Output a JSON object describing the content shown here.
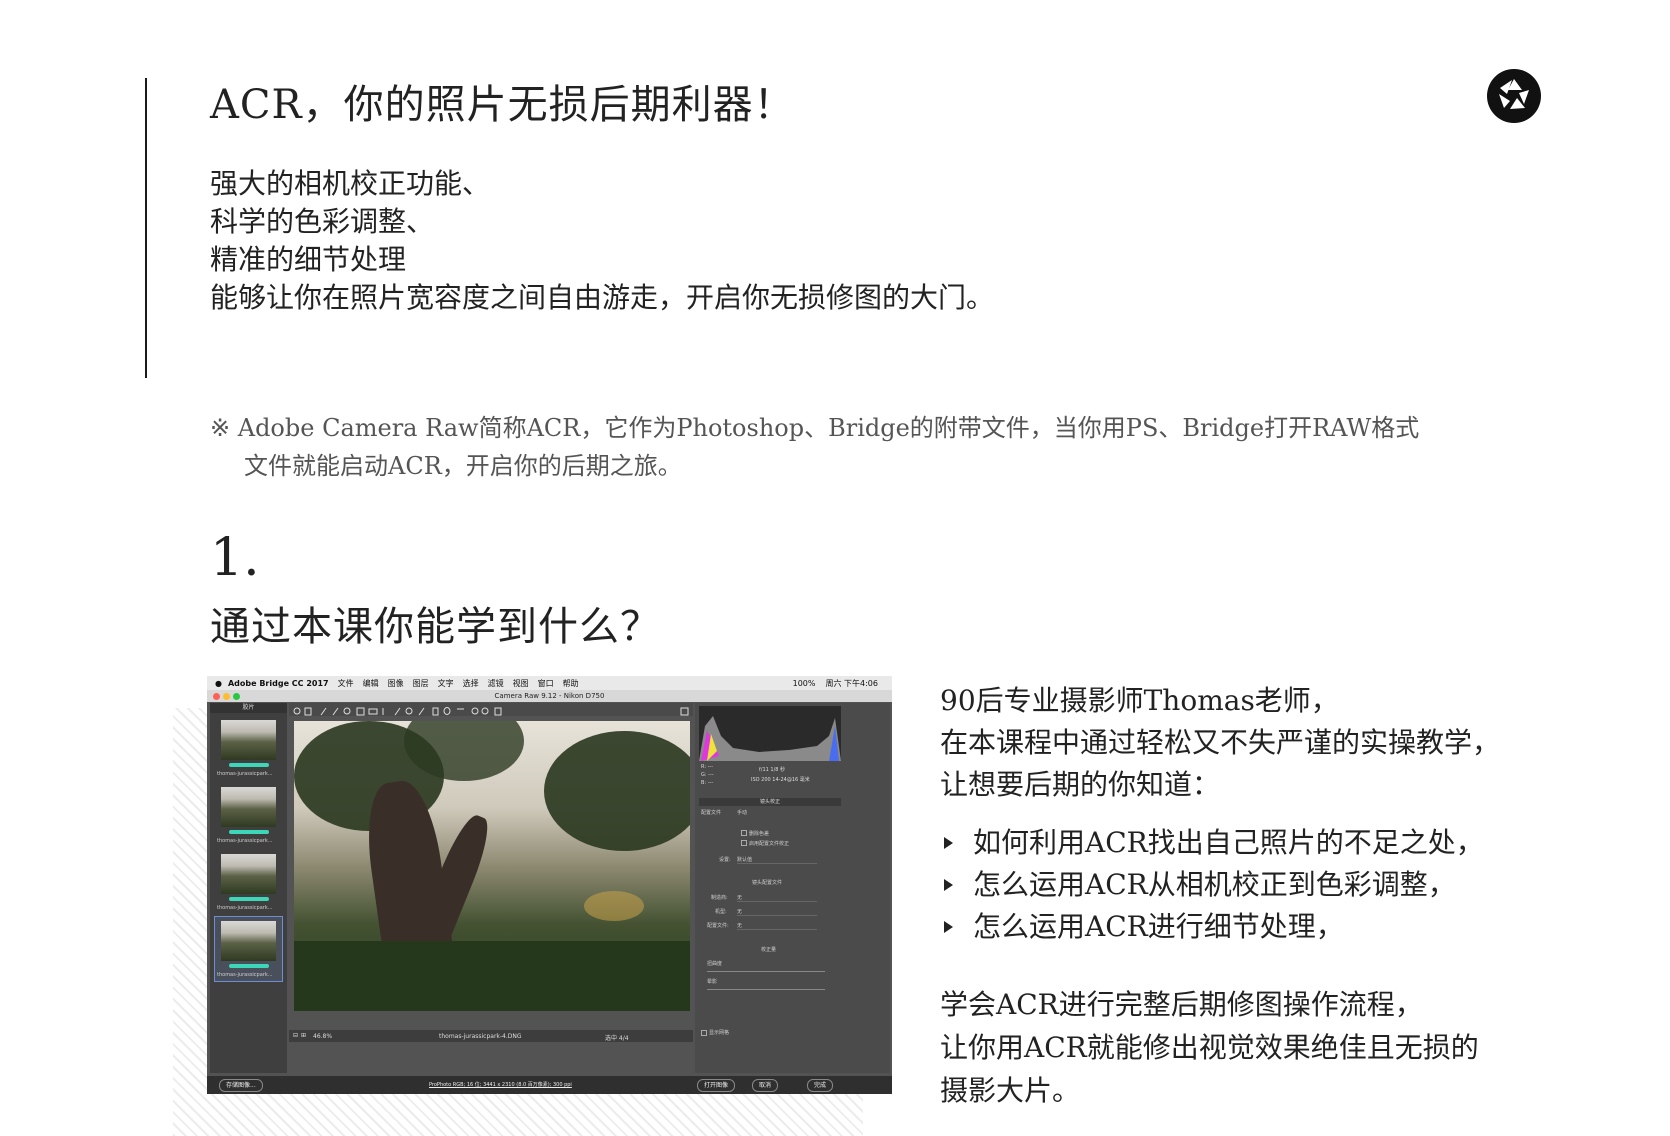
{
  "header": {
    "title": "ACR，你的照片无损后期利器！"
  },
  "intro": {
    "lines": [
      "强大的相机校正功能、",
      "科学的色彩调整、",
      "精准的细节处理",
      "能够让你在照片宽容度之间自由游走，开启你无损修图的大门。"
    ]
  },
  "note": {
    "line1": "※ Adobe Camera Raw简称ACR，它作为Photoshop、Bridge的附带文件，当你用PS、Bridge打开RAW格式",
    "line2": "文件就能启动ACR，开启你的后期之旅。"
  },
  "section": {
    "number": "1.",
    "title": "通过本课你能学到什么？"
  },
  "description": {
    "para1": [
      "90后专业摄影师Thomas老师，",
      "在本课程中通过轻松又不失严谨的实操教学，",
      "让想要后期的你知道："
    ],
    "bullets": [
      "如何利用ACR找出自己照片的不足之处，",
      "怎么运用ACR从相机校正到色彩调整，",
      "怎么运用ACR进行细节处理，"
    ],
    "para2": [
      "学会ACR进行完整后期修图操作流程，",
      "让你用ACR就能修出视觉效果绝佳且无损的",
      "摄影大片。"
    ]
  },
  "screenshot": {
    "menubar": {
      "app": "Adobe Bridge CC 2017",
      "items": [
        "文件",
        "编辑",
        "图像",
        "图层",
        "文字",
        "选择",
        "滤镜",
        "视图",
        "窗口",
        "帮助"
      ],
      "zoom_status": "100%",
      "clock": "周六 下午4:06"
    },
    "window_title": "Camera Raw 9.12 - Nikon D750",
    "filmstrip": {
      "header": "胶片",
      "items": [
        "thomas-jurassicpark...",
        "thomas-jurassicpark...",
        "thomas-jurassicpark...",
        "thomas-jurassicpark..."
      ]
    },
    "status": {
      "zoom": "46.8%",
      "filename": "thomas-jurassicpark-4.DNG",
      "selection": "选中 4/4"
    },
    "meta": {
      "rgb": [
        "R: ---",
        "G: ---",
        "B: ---"
      ],
      "exposure": "f/11   1/8 秒",
      "iso": "ISO 200   14-24@16 毫米"
    },
    "panel": {
      "title": "镜头校正",
      "tabs": [
        "配置文件",
        "手动"
      ],
      "checkboxes": [
        "删除色差",
        "启用配置文件校正"
      ],
      "setting_label": "设置:",
      "setting_value": "默认值",
      "section_profile": "镜头配置文件",
      "fields": [
        [
          "制造商:",
          "无"
        ],
        [
          "机型:",
          "无"
        ],
        [
          "配置文件:",
          "无"
        ]
      ],
      "section_amount": "校正量",
      "sliders": [
        "扭曲度",
        "晕影"
      ],
      "grid_label": "显示网格"
    },
    "bottom": {
      "save": "存储图像...",
      "info": "ProPhoto RGB; 16 位; 3441 x 2310 (8.0 百万像素); 300 ppi",
      "open": "打开图像",
      "cancel": "取消",
      "done": "完成"
    }
  },
  "colors": {
    "accent_teal": "#3dd6b8",
    "ui_gray": "#535353",
    "text_dark": "#222222"
  },
  "icons": [
    "aperture-logo-icon",
    "apple-icon",
    "zoom-tool-icon",
    "hand-tool-icon",
    "histogram-icon"
  ]
}
